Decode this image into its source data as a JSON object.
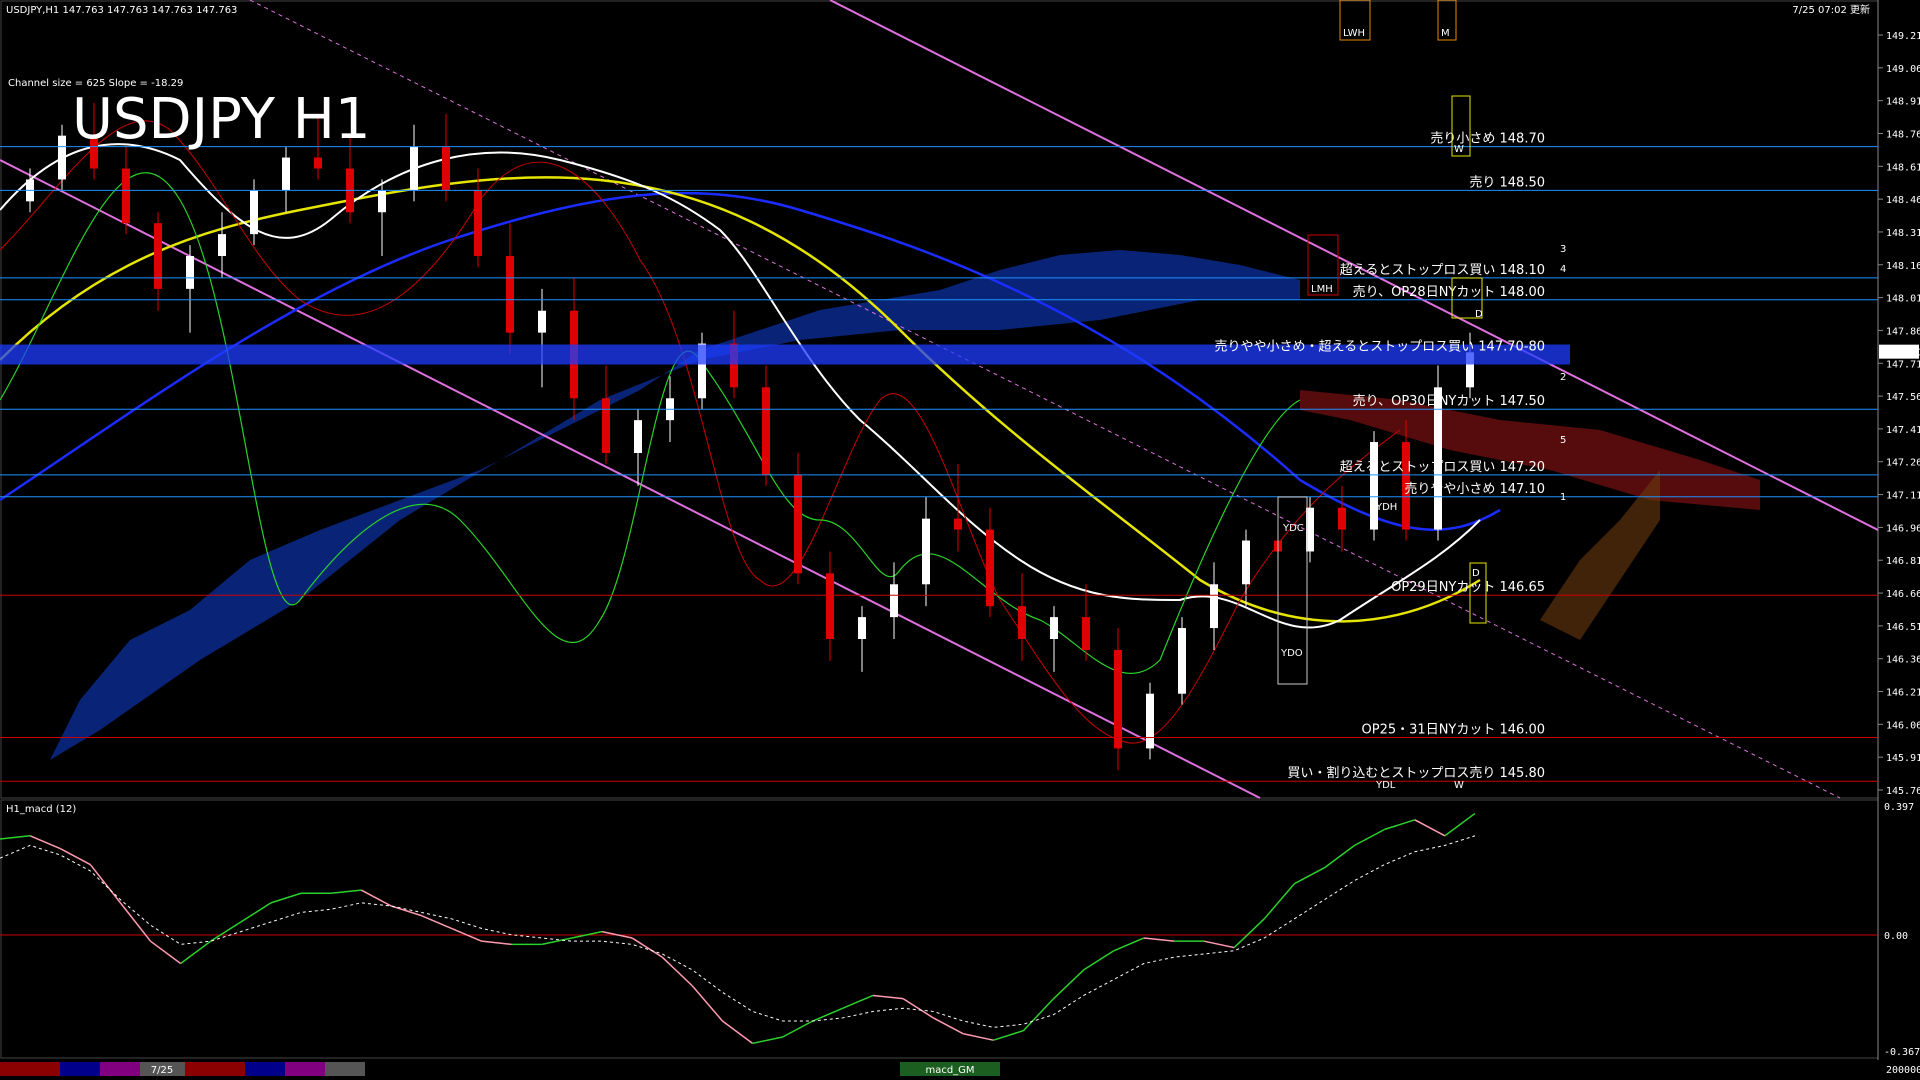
{
  "header": {
    "symbol_info": "USDJPY,H1  147.763 147.763 147.763 147.763",
    "update_time": "7/25 07:02 更新",
    "channel_info": "Channel size = 625 Slope = -18.29",
    "big_title": "USDJPY H1"
  },
  "chart_data": [
    {
      "type": "candlestick",
      "title": "USDJPY H1",
      "ylim": [
        145.76,
        149.21
      ],
      "y_ticks": [
        "149.210",
        "149.060",
        "148.910",
        "148.760",
        "148.610",
        "148.460",
        "148.310",
        "148.160",
        "148.010",
        "147.860",
        "147.710",
        "147.560",
        "147.410",
        "147.260",
        "147.110",
        "146.960",
        "146.810",
        "146.660",
        "146.510",
        "146.360",
        "146.210",
        "146.060",
        "145.910",
        "145.760"
      ],
      "current_price": "147.763",
      "levels": [
        {
          "label": "売り小さめ 148.70",
          "value": 148.7,
          "color": "#1e90ff"
        },
        {
          "label": "売り 148.50",
          "value": 148.5,
          "color": "#1e90ff"
        },
        {
          "label": "超えるとストップロス買い 148.10",
          "value": 148.1,
          "color": "#1e90ff"
        },
        {
          "label": "売り、OP28日NYカット 148.00",
          "value": 148.0,
          "color": "#1e90ff"
        },
        {
          "label": "売りやや小さめ・超えるとストップロス買い 147.70-80",
          "value": 147.75,
          "color": "#1e3cff"
        },
        {
          "label": "売り、OP30日NYカット 147.50",
          "value": 147.5,
          "color": "#1e90ff"
        },
        {
          "label": "超えるとストップロス買い 147.20",
          "value": 147.2,
          "color": "#1e90ff"
        },
        {
          "label": "売りやや小さめ 147.10",
          "value": 147.1,
          "color": "#1e90ff"
        },
        {
          "label": "OP29日NYカット 146.65",
          "value": 146.65,
          "color": "#cc0000"
        },
        {
          "label": "OP25・31日NYカット 146.00",
          "value": 146.0,
          "color": "#cc0000"
        },
        {
          "label": "買い・割り込むとストップロス売り 145.80",
          "value": 145.8,
          "color": "#cc0000"
        }
      ],
      "candles": [
        [
          148.45,
          148.6,
          148.4,
          148.55
        ],
        [
          148.55,
          148.8,
          148.5,
          148.75
        ],
        [
          148.75,
          148.9,
          148.55,
          148.6
        ],
        [
          148.6,
          148.7,
          148.3,
          148.35
        ],
        [
          148.35,
          148.4,
          147.95,
          148.05
        ],
        [
          148.05,
          148.25,
          147.85,
          148.2
        ],
        [
          148.2,
          148.4,
          148.1,
          148.3
        ],
        [
          148.3,
          148.55,
          148.25,
          148.5
        ],
        [
          148.5,
          148.7,
          148.4,
          148.65
        ],
        [
          148.65,
          148.85,
          148.55,
          148.6
        ],
        [
          148.6,
          148.75,
          148.35,
          148.4
        ],
        [
          148.4,
          148.55,
          148.2,
          148.5
        ],
        [
          148.5,
          148.8,
          148.45,
          148.7
        ],
        [
          148.7,
          148.85,
          148.45,
          148.5
        ],
        [
          148.5,
          148.6,
          148.15,
          148.2
        ],
        [
          148.2,
          148.35,
          147.75,
          147.85
        ],
        [
          147.85,
          148.05,
          147.6,
          147.95
        ],
        [
          147.95,
          148.1,
          147.45,
          147.55
        ],
        [
          147.55,
          147.7,
          147.25,
          147.3
        ],
        [
          147.3,
          147.5,
          147.15,
          147.45
        ],
        [
          147.45,
          147.65,
          147.35,
          147.55
        ],
        [
          147.55,
          147.85,
          147.5,
          147.8
        ],
        [
          147.8,
          147.95,
          147.55,
          147.6
        ],
        [
          147.6,
          147.7,
          147.15,
          147.2
        ],
        [
          147.2,
          147.3,
          146.7,
          146.75
        ],
        [
          146.75,
          146.85,
          146.35,
          146.45
        ],
        [
          146.45,
          146.6,
          146.3,
          146.55
        ],
        [
          146.55,
          146.8,
          146.45,
          146.7
        ],
        [
          146.7,
          147.1,
          146.6,
          147.0
        ],
        [
          147.0,
          147.25,
          146.85,
          146.95
        ],
        [
          146.95,
          147.05,
          146.55,
          146.6
        ],
        [
          146.6,
          146.75,
          146.35,
          146.45
        ],
        [
          146.45,
          146.6,
          146.3,
          146.55
        ],
        [
          146.55,
          146.7,
          146.35,
          146.4
        ],
        [
          146.4,
          146.5,
          145.85,
          145.95
        ],
        [
          145.95,
          146.25,
          145.9,
          146.2
        ],
        [
          146.2,
          146.55,
          146.15,
          146.5
        ],
        [
          146.5,
          146.8,
          146.4,
          146.7
        ],
        [
          146.7,
          146.95,
          146.6,
          146.9
        ],
        [
          146.9,
          147.0,
          146.75,
          146.85
        ],
        [
          146.85,
          147.1,
          146.8,
          147.05
        ],
        [
          147.05,
          147.15,
          146.85,
          146.95
        ],
        [
          146.95,
          147.4,
          146.9,
          147.35
        ],
        [
          147.35,
          147.45,
          146.9,
          146.95
        ],
        [
          146.95,
          147.7,
          146.9,
          147.6
        ],
        [
          147.6,
          147.85,
          147.55,
          147.76
        ]
      ],
      "macd": {
        "title": "H1_macd (12)",
        "ylim": [
          -0.367,
          0.397
        ],
        "y_ticks": [
          "0.397",
          "0.00",
          "-0.367"
        ],
        "macd_line": [
          0.3,
          0.31,
          0.27,
          0.22,
          0.1,
          -0.02,
          -0.09,
          -0.02,
          0.04,
          0.1,
          0.13,
          0.13,
          0.14,
          0.09,
          0.06,
          0.02,
          -0.02,
          -0.03,
          -0.03,
          -0.01,
          0.01,
          -0.01,
          -0.07,
          -0.16,
          -0.27,
          -0.34,
          -0.32,
          -0.27,
          -0.23,
          -0.19,
          -0.2,
          -0.26,
          -0.31,
          -0.33,
          -0.3,
          -0.2,
          -0.11,
          -0.05,
          -0.01,
          -0.02,
          -0.02,
          -0.04,
          0.05,
          0.16,
          0.21,
          0.28,
          0.33,
          0.36,
          0.31,
          0.38
        ],
        "signal_line": [
          0.24,
          0.28,
          0.25,
          0.2,
          0.11,
          0.03,
          -0.03,
          -0.02,
          0.01,
          0.04,
          0.07,
          0.08,
          0.1,
          0.09,
          0.07,
          0.05,
          0.02,
          0.0,
          -0.01,
          -0.02,
          -0.02,
          -0.03,
          -0.06,
          -0.11,
          -0.18,
          -0.24,
          -0.27,
          -0.27,
          -0.26,
          -0.24,
          -0.23,
          -0.24,
          -0.27,
          -0.29,
          -0.28,
          -0.25,
          -0.19,
          -0.14,
          -0.09,
          -0.07,
          -0.06,
          -0.05,
          -0.01,
          0.05,
          0.11,
          0.17,
          0.22,
          0.26,
          0.28,
          0.31
        ]
      }
    }
  ],
  "markers": {
    "ydc": "YDC",
    "ydo": "YDO",
    "ydl": "YDL",
    "ydh": "YDH",
    "lwh": "LWH",
    "lmh": "LMH",
    "m": "M",
    "w": "W",
    "d": "D"
  },
  "fib_labels": [
    "3",
    "4",
    "2",
    "5",
    "1"
  ],
  "bottom_bar": {
    "date_label": "7/25",
    "macd_label": "macd_GM",
    "scale_value": "200000"
  }
}
